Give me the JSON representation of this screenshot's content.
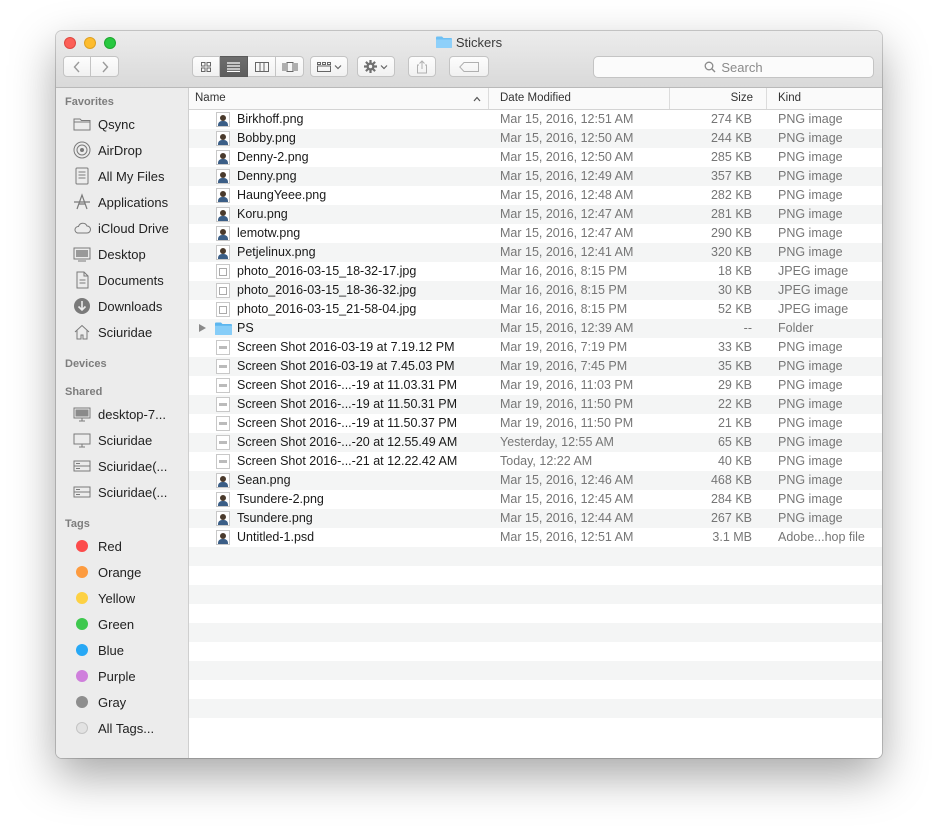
{
  "window": {
    "title": "Stickers",
    "search_placeholder": "Search"
  },
  "toolbar": {
    "back_icon": "chevron-left-icon",
    "forward_icon": "chevron-right-icon",
    "view_modes": [
      "icon-view-icon",
      "list-view-icon",
      "column-view-icon",
      "cover-flow-icon"
    ],
    "active_view": "list-view-icon",
    "arrange_icon": "arrange-grid-icon",
    "action_icon": "gear-icon",
    "share_icon": "share-icon",
    "tag_icon": "tag-icon"
  },
  "sidebar": {
    "favorites_title": "Favorites",
    "favorites": [
      {
        "label": "Qsync",
        "icon": "folder-icon"
      },
      {
        "label": "AirDrop",
        "icon": "airdrop-icon"
      },
      {
        "label": "All My Files",
        "icon": "all-files-icon"
      },
      {
        "label": "Applications",
        "icon": "applications-icon"
      },
      {
        "label": "iCloud Drive",
        "icon": "cloud-icon"
      },
      {
        "label": "Desktop",
        "icon": "desktop-icon"
      },
      {
        "label": "Documents",
        "icon": "documents-icon"
      },
      {
        "label": "Downloads",
        "icon": "downloads-icon"
      },
      {
        "label": "Sciuridae",
        "icon": "home-icon"
      }
    ],
    "devices_title": "Devices",
    "shared_title": "Shared",
    "shared": [
      {
        "label": "desktop-7...",
        "icon": "display-icon"
      },
      {
        "label": "Sciuridae",
        "icon": "display-icon"
      },
      {
        "label": "Sciuridae(...",
        "icon": "server-icon"
      },
      {
        "label": "Sciuridae(...",
        "icon": "server-icon"
      }
    ],
    "tags_title": "Tags",
    "tags": [
      {
        "label": "Red",
        "color": "#fc4b4b"
      },
      {
        "label": "Orange",
        "color": "#fd9b3f"
      },
      {
        "label": "Yellow",
        "color": "#fdd143"
      },
      {
        "label": "Green",
        "color": "#3ec84e"
      },
      {
        "label": "Blue",
        "color": "#27a8f5"
      },
      {
        "label": "Purple",
        "color": "#cf7fdc"
      },
      {
        "label": "Gray",
        "color": "#8e8e8e"
      },
      {
        "label": "All Tags...",
        "color": "#d8d8d8"
      }
    ]
  },
  "list": {
    "columns": {
      "name": "Name",
      "date": "Date Modified",
      "size": "Size",
      "kind": "Kind"
    },
    "files": [
      {
        "name": "Birkhoff.png",
        "date": "Mar 15, 2016, 12:51 AM",
        "size": "274 KB",
        "kind": "PNG image",
        "thumb": "photo"
      },
      {
        "name": "Bobby.png",
        "date": "Mar 15, 2016, 12:50 AM",
        "size": "244 KB",
        "kind": "PNG image",
        "thumb": "photo"
      },
      {
        "name": "Denny-2.png",
        "date": "Mar 15, 2016, 12:50 AM",
        "size": "285 KB",
        "kind": "PNG image",
        "thumb": "photo"
      },
      {
        "name": "Denny.png",
        "date": "Mar 15, 2016, 12:49 AM",
        "size": "357 KB",
        "kind": "PNG image",
        "thumb": "photo"
      },
      {
        "name": "HaungYeee.png",
        "date": "Mar 15, 2016, 12:48 AM",
        "size": "282 KB",
        "kind": "PNG image",
        "thumb": "photo"
      },
      {
        "name": "Koru.png",
        "date": "Mar 15, 2016, 12:47 AM",
        "size": "281 KB",
        "kind": "PNG image",
        "thumb": "photo"
      },
      {
        "name": "lemotw.png",
        "date": "Mar 15, 2016, 12:47 AM",
        "size": "290 KB",
        "kind": "PNG image",
        "thumb": "photo"
      },
      {
        "name": "Petjelinux.png",
        "date": "Mar 15, 2016, 12:41 AM",
        "size": "320 KB",
        "kind": "PNG image",
        "thumb": "photo"
      },
      {
        "name": "photo_2016-03-15_18-32-17.jpg",
        "date": "Mar 16, 2016, 8:15 PM",
        "size": "18 KB",
        "kind": "JPEG image",
        "thumb": "jpg"
      },
      {
        "name": "photo_2016-03-15_18-36-32.jpg",
        "date": "Mar 16, 2016, 8:15 PM",
        "size": "30 KB",
        "kind": "JPEG image",
        "thumb": "jpg"
      },
      {
        "name": "photo_2016-03-15_21-58-04.jpg",
        "date": "Mar 16, 2016, 8:15 PM",
        "size": "52 KB",
        "kind": "JPEG image",
        "thumb": "jpg"
      },
      {
        "name": "PS",
        "date": "Mar 15, 2016, 12:39 AM",
        "size": "--",
        "kind": "Folder",
        "thumb": "folder"
      },
      {
        "name": "Screen Shot 2016-03-19 at 7.19.12 PM",
        "date": "Mar 19, 2016, 7:19 PM",
        "size": "33 KB",
        "kind": "PNG image",
        "thumb": "screen"
      },
      {
        "name": "Screen Shot 2016-03-19 at 7.45.03 PM",
        "date": "Mar 19, 2016, 7:45 PM",
        "size": "35 KB",
        "kind": "PNG image",
        "thumb": "screen"
      },
      {
        "name": "Screen Shot 2016-...-19 at 11.03.31 PM",
        "date": "Mar 19, 2016, 11:03 PM",
        "size": "29 KB",
        "kind": "PNG image",
        "thumb": "screen"
      },
      {
        "name": "Screen Shot 2016-...-19 at 11.50.31 PM",
        "date": "Mar 19, 2016, 11:50 PM",
        "size": "22 KB",
        "kind": "PNG image",
        "thumb": "screen"
      },
      {
        "name": "Screen Shot 2016-...-19 at 11.50.37 PM",
        "date": "Mar 19, 2016, 11:50 PM",
        "size": "21 KB",
        "kind": "PNG image",
        "thumb": "screen"
      },
      {
        "name": "Screen Shot 2016-...-20 at 12.55.49 AM",
        "date": "Yesterday, 12:55 AM",
        "size": "65 KB",
        "kind": "PNG image",
        "thumb": "screen"
      },
      {
        "name": "Screen Shot 2016-...-21 at 12.22.42 AM",
        "date": "Today, 12:22 AM",
        "size": "40 KB",
        "kind": "PNG image",
        "thumb": "screen"
      },
      {
        "name": "Sean.png",
        "date": "Mar 15, 2016, 12:46 AM",
        "size": "468 KB",
        "kind": "PNG image",
        "thumb": "photo"
      },
      {
        "name": "Tsundere-2.png",
        "date": "Mar 15, 2016, 12:45 AM",
        "size": "284 KB",
        "kind": "PNG image",
        "thumb": "photo"
      },
      {
        "name": "Tsundere.png",
        "date": "Mar 15, 2016, 12:44 AM",
        "size": "267 KB",
        "kind": "PNG image",
        "thumb": "photo"
      },
      {
        "name": "Untitled-1.psd",
        "date": "Mar 15, 2016, 12:51 AM",
        "size": "3.1 MB",
        "kind": "Adobe...hop file",
        "thumb": "photo"
      }
    ]
  }
}
